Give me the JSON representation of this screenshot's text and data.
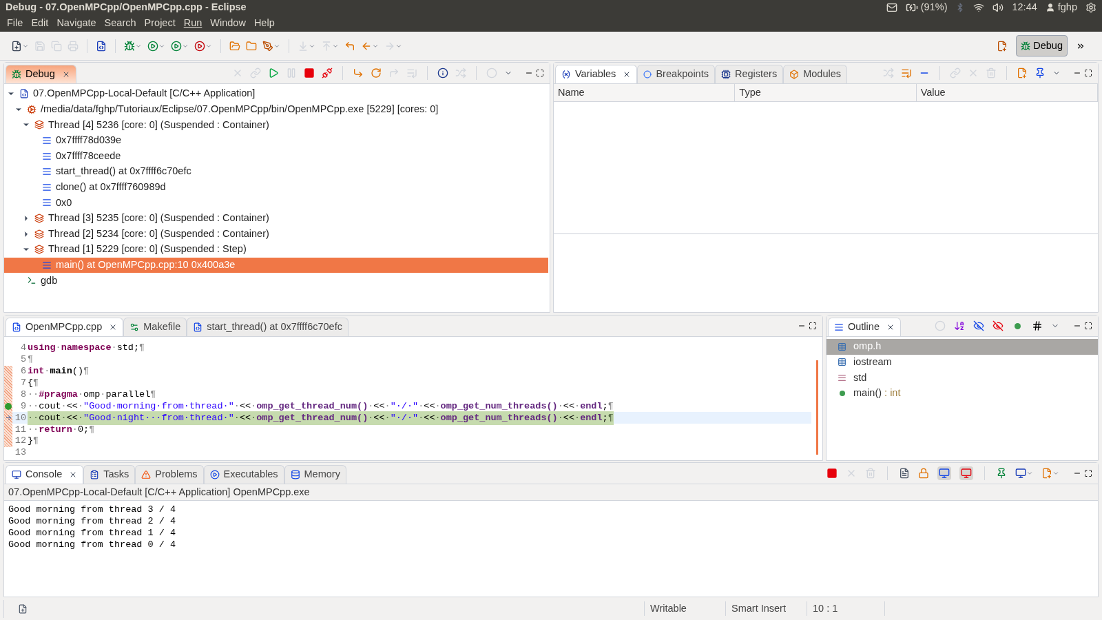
{
  "window": {
    "title": "Debug - 07.OpenMPCpp/OpenMPCpp.cpp - Eclipse"
  },
  "tray": {
    "battery": "(91%)",
    "time": "12:44",
    "user": "fghp"
  },
  "menu": [
    {
      "label": "File",
      "underlined": false
    },
    {
      "label": "Edit",
      "underlined": false
    },
    {
      "label": "Navigate",
      "underlined": false
    },
    {
      "label": "Search",
      "underlined": false
    },
    {
      "label": "Project",
      "underlined": false
    },
    {
      "label": "Run",
      "underlined": true
    },
    {
      "label": "Window",
      "underlined": false
    },
    {
      "label": "Help",
      "underlined": false
    }
  ],
  "perspective": {
    "label": "Debug",
    "selected": true
  },
  "debug_view": {
    "focused": true,
    "tabs": [
      {
        "label": "Debug",
        "selected": true
      }
    ],
    "tree": [
      {
        "label": "07.OpenMPCpp-Local-Default [C/C++ Application]",
        "kind": "launch",
        "expanded": true,
        "selected": false,
        "children": [
          {
            "label": "/media/data/fghp/Tutoriaux/Eclipse/07.OpenMPCpp/bin/OpenMPCpp.exe [5229] [cores: 0]",
            "kind": "process",
            "expanded": true,
            "selected": false,
            "children": [
              {
                "label": "Thread [4] 5236 [core: 0] (Suspended : Container)",
                "kind": "thread",
                "expanded": true,
                "selected": false,
                "children": [
                  {
                    "label": "0x7ffff78d039e",
                    "kind": "frame",
                    "selected": false
                  },
                  {
                    "label": "0x7ffff78ceede",
                    "kind": "frame",
                    "selected": false
                  },
                  {
                    "label": "start_thread() at 0x7ffff6c70efc",
                    "kind": "frame",
                    "selected": false
                  },
                  {
                    "label": "clone() at 0x7ffff760989d",
                    "kind": "frame",
                    "selected": false
                  },
                  {
                    "label": "0x0",
                    "kind": "frame",
                    "selected": false
                  }
                ]
              },
              {
                "label": "Thread [3] 5235 [core: 0] (Suspended : Container)",
                "kind": "thread",
                "expanded": false,
                "selected": false
              },
              {
                "label": "Thread [2] 5234 [core: 0] (Suspended : Container)",
                "kind": "thread",
                "expanded": false,
                "selected": false
              },
              {
                "label": "Thread [1] 5229 [core: 0] (Suspended : Step)",
                "kind": "thread",
                "expanded": true,
                "selected": false,
                "children": [
                  {
                    "label": "main() at OpenMPCpp.cpp:10 0x400a3e",
                    "kind": "frame",
                    "selected": true
                  }
                ]
              }
            ]
          },
          {
            "label": "gdb",
            "kind": "gdb",
            "selected": false
          }
        ]
      }
    ]
  },
  "variables_view": {
    "tabs": [
      {
        "label": "Variables",
        "selected": true,
        "kind": "variables"
      },
      {
        "label": "Breakpoints",
        "selected": false,
        "kind": "breakpoints"
      },
      {
        "label": "Registers",
        "selected": false,
        "kind": "registers"
      },
      {
        "label": "Modules",
        "selected": false,
        "kind": "modules"
      }
    ],
    "columns": [
      "Name",
      "Type",
      "Value"
    ]
  },
  "editor": {
    "tabs": [
      {
        "label": "OpenMPCpp.cpp",
        "selected": true,
        "kind": "cpp"
      },
      {
        "label": "Makefile",
        "selected": false,
        "kind": "make"
      },
      {
        "label": "start_thread() at 0x7ffff6c70efc",
        "selected": false,
        "kind": "cpp"
      }
    ],
    "lines": [
      {
        "number": "4",
        "range": false,
        "breakpoint": false,
        "instruction_pointer": false,
        "current": false,
        "tokens": [
          {
            "text": "using",
            "kind": "keyword"
          },
          {
            "text": "·",
            "kind": "space"
          },
          {
            "text": "namespace",
            "kind": "keyword"
          },
          {
            "text": "·",
            "kind": "space"
          },
          {
            "text": "std;",
            "kind": "plain"
          },
          {
            "text": "¶",
            "kind": "space"
          }
        ]
      },
      {
        "number": "5",
        "range": false,
        "breakpoint": false,
        "instruction_pointer": false,
        "current": false,
        "tokens": [
          {
            "text": "¶",
            "kind": "space"
          }
        ]
      },
      {
        "number": "6",
        "range": true,
        "breakpoint": false,
        "instruction_pointer": false,
        "current": false,
        "tokens": [
          {
            "text": "int",
            "kind": "keyword"
          },
          {
            "text": "·",
            "kind": "space"
          },
          {
            "text": "main",
            "kind": "bold"
          },
          {
            "text": "()",
            "kind": "plain"
          },
          {
            "text": "¶",
            "kind": "space"
          }
        ]
      },
      {
        "number": "7",
        "range": true,
        "breakpoint": false,
        "instruction_pointer": false,
        "current": false,
        "tokens": [
          {
            "text": "{",
            "kind": "plain"
          },
          {
            "text": "¶",
            "kind": "space"
          }
        ]
      },
      {
        "number": "8",
        "range": true,
        "breakpoint": false,
        "instruction_pointer": false,
        "current": false,
        "tokens": [
          {
            "text": "··",
            "kind": "space"
          },
          {
            "text": "#pragma",
            "kind": "keyword"
          },
          {
            "text": "·",
            "kind": "space"
          },
          {
            "text": "omp",
            "kind": "plain"
          },
          {
            "text": "·",
            "kind": "space"
          },
          {
            "text": "parallel",
            "kind": "plain"
          },
          {
            "text": "¶",
            "kind": "space"
          }
        ]
      },
      {
        "number": "9",
        "range": true,
        "breakpoint": true,
        "instruction_pointer": false,
        "current": false,
        "tokens": [
          {
            "text": "··",
            "kind": "space"
          },
          {
            "text": "cout",
            "kind": "plain"
          },
          {
            "text": "·",
            "kind": "space"
          },
          {
            "text": "<<",
            "kind": "plain"
          },
          {
            "text": "·",
            "kind": "space"
          },
          {
            "text": "\"Good·morning·from·thread·\"",
            "kind": "string"
          },
          {
            "text": "·",
            "kind": "space"
          },
          {
            "text": "<<",
            "kind": "plain"
          },
          {
            "text": "·",
            "kind": "space"
          },
          {
            "text": "omp_get_thread_num()",
            "kind": "function"
          },
          {
            "text": "·",
            "kind": "space"
          },
          {
            "text": "<<",
            "kind": "plain"
          },
          {
            "text": "·",
            "kind": "space"
          },
          {
            "text": "\"·/·\"",
            "kind": "string"
          },
          {
            "text": "·",
            "kind": "space"
          },
          {
            "text": "<<",
            "kind": "plain"
          },
          {
            "text": "·",
            "kind": "space"
          },
          {
            "text": "omp_get_num_threads()",
            "kind": "function"
          },
          {
            "text": "·",
            "kind": "space"
          },
          {
            "text": "<<",
            "kind": "plain"
          },
          {
            "text": "·",
            "kind": "space"
          },
          {
            "text": "endl",
            "kind": "function"
          },
          {
            "text": ";",
            "kind": "plain"
          },
          {
            "text": "¶",
            "kind": "space"
          }
        ]
      },
      {
        "number": "10",
        "range": true,
        "breakpoint": false,
        "instruction_pointer": true,
        "current": true,
        "tokens": [
          {
            "text": "··",
            "kind": "space"
          },
          {
            "text": "cout",
            "kind": "plain"
          },
          {
            "text": "·",
            "kind": "space"
          },
          {
            "text": "<<",
            "kind": "plain"
          },
          {
            "text": "·",
            "kind": "space"
          },
          {
            "text": "\"Good·night···from·thread·\"",
            "kind": "string"
          },
          {
            "text": "·",
            "kind": "space"
          },
          {
            "text": "<<",
            "kind": "plain"
          },
          {
            "text": "·",
            "kind": "space"
          },
          {
            "text": "omp_get_thread_num()",
            "kind": "function"
          },
          {
            "text": "·",
            "kind": "space"
          },
          {
            "text": "<<",
            "kind": "plain"
          },
          {
            "text": "·",
            "kind": "space"
          },
          {
            "text": "\"·/·\"",
            "kind": "string"
          },
          {
            "text": "·",
            "kind": "space"
          },
          {
            "text": "<<",
            "kind": "plain"
          },
          {
            "text": "·",
            "kind": "space"
          },
          {
            "text": "omp_get_num_threads()",
            "kind": "function"
          },
          {
            "text": "·",
            "kind": "space"
          },
          {
            "text": "<<",
            "kind": "plain"
          },
          {
            "text": "·",
            "kind": "space"
          },
          {
            "text": "endl",
            "kind": "function"
          },
          {
            "text": ";",
            "kind": "plain"
          },
          {
            "text": "¶",
            "kind": "space"
          }
        ]
      },
      {
        "number": "11",
        "range": true,
        "breakpoint": false,
        "instruction_pointer": false,
        "current": false,
        "tokens": [
          {
            "text": "··",
            "kind": "space"
          },
          {
            "text": "return",
            "kind": "keyword"
          },
          {
            "text": "·",
            "kind": "space"
          },
          {
            "text": "0;",
            "kind": "plain"
          },
          {
            "text": "¶",
            "kind": "space"
          }
        ]
      },
      {
        "number": "12",
        "range": true,
        "breakpoint": false,
        "instruction_pointer": false,
        "current": false,
        "tokens": [
          {
            "text": "}",
            "kind": "plain"
          },
          {
            "text": "¶",
            "kind": "space"
          }
        ]
      },
      {
        "number": "13",
        "range": false,
        "breakpoint": false,
        "instruction_pointer": false,
        "current": false
      }
    ]
  },
  "outline": {
    "tabs": [
      {
        "label": "Outline",
        "selected": true
      }
    ],
    "items": [
      {
        "label": "omp.h",
        "kind": "include",
        "selected": true
      },
      {
        "label": "iostream",
        "kind": "include",
        "selected": false
      },
      {
        "label": "std",
        "kind": "namespace",
        "selected": false
      },
      {
        "label": "main()",
        "type": ": int",
        "kind": "function",
        "selected": false
      }
    ]
  },
  "console": {
    "tabs": [
      {
        "label": "Console",
        "selected": true,
        "kind": "console"
      },
      {
        "label": "Tasks",
        "selected": false,
        "kind": "tasks"
      },
      {
        "label": "Problems",
        "selected": false,
        "kind": "problems"
      },
      {
        "label": "Executables",
        "selected": false,
        "kind": "executables"
      },
      {
        "label": "Memory",
        "selected": false,
        "kind": "memory"
      }
    ],
    "process": "07.OpenMPCpp-Local-Default [C/C++ Application] OpenMPCpp.exe",
    "output": [
      "Good morning from thread 3 / 4",
      "Good morning from thread 2 / 4",
      "Good morning from thread 1 / 4",
      "Good morning from thread 0 / 4"
    ]
  },
  "status_bar": {
    "mode": "Writable",
    "insert": "Smart Insert",
    "position": "10 : 1"
  }
}
